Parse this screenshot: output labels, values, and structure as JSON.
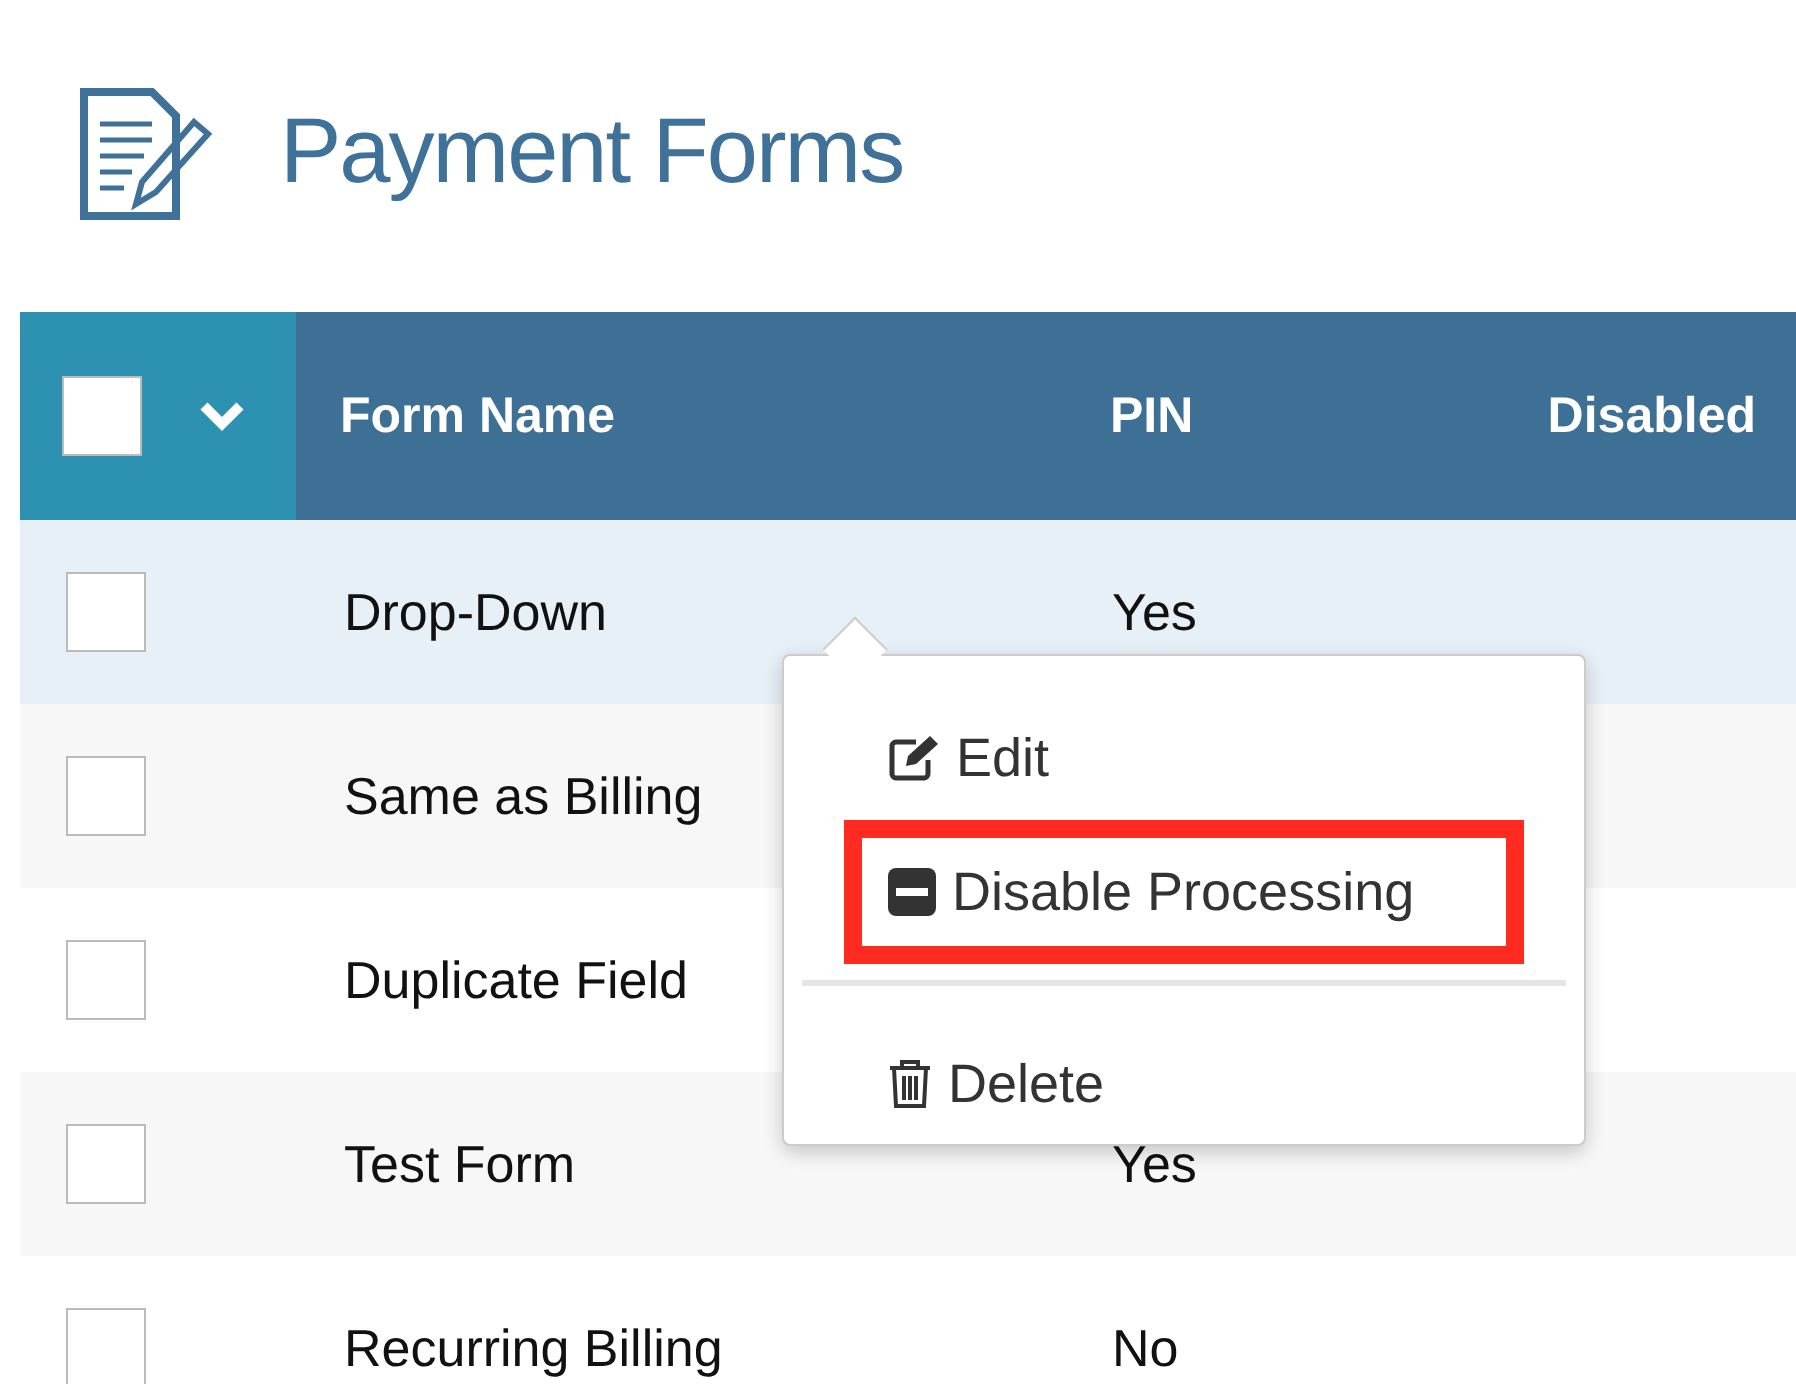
{
  "page_title": "Payment Forms",
  "table": {
    "select_all": {
      "checked": false
    },
    "columns": [
      "Form Name",
      "PIN",
      "Disabled"
    ],
    "rows": [
      {
        "checked": false,
        "selected": true,
        "cells": [
          "Drop-Down",
          "Yes",
          ""
        ]
      },
      {
        "checked": false,
        "selected": false,
        "cells": [
          "Same as Billing",
          "",
          ""
        ]
      },
      {
        "checked": false,
        "selected": false,
        "cells": [
          "Duplicate Field",
          "",
          ""
        ]
      },
      {
        "checked": false,
        "selected": false,
        "cells": [
          "Test Form",
          "Yes",
          ""
        ]
      },
      {
        "checked": false,
        "selected": false,
        "cells": [
          "Recurring Billing",
          "No",
          ""
        ]
      }
    ]
  },
  "context_menu": {
    "items": [
      {
        "kind": "edit",
        "label": "Edit",
        "highlighted": false
      },
      {
        "kind": "disable",
        "label": "Disable Processing",
        "highlighted": true
      },
      {
        "kind": "divider"
      },
      {
        "kind": "delete",
        "label": "Delete",
        "highlighted": false
      }
    ]
  }
}
